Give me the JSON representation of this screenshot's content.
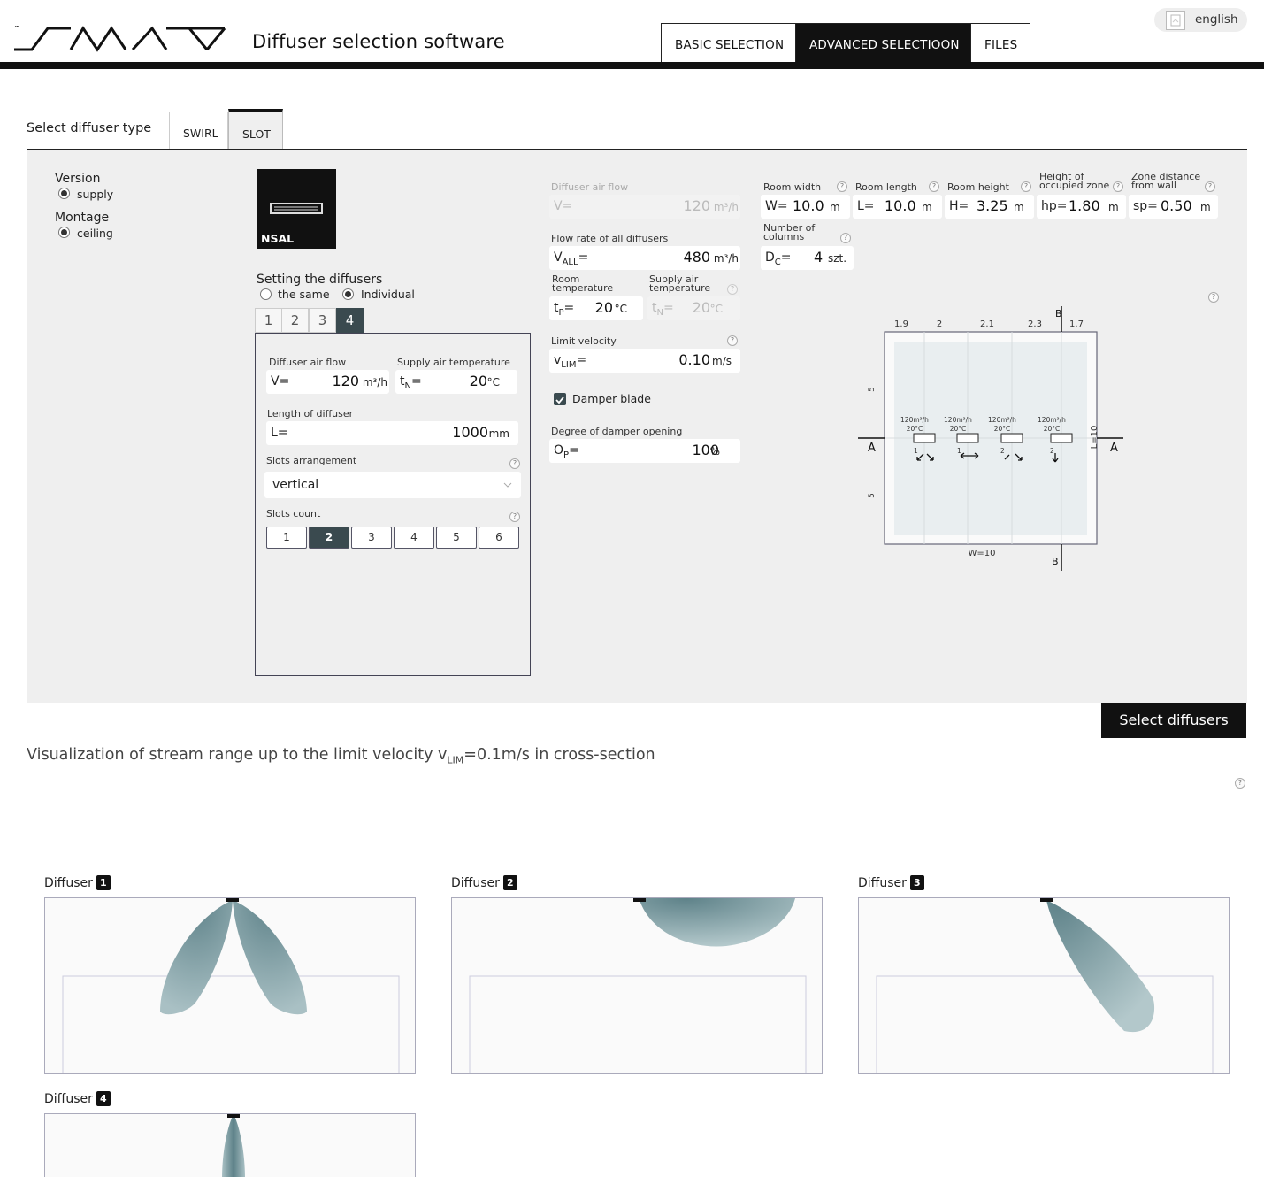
{
  "header": {
    "logo_tm": "™",
    "app_title": "Diffuser selection software",
    "tabs": [
      {
        "label": "BASIC SELECTION",
        "active": false
      },
      {
        "label": "ADVANCED SELECTIOON",
        "active": true
      },
      {
        "label": "FILES",
        "active": false
      }
    ],
    "language": "english"
  },
  "type_selector": {
    "label": "Select diffuser type",
    "tabs": [
      {
        "label": "SWIRL",
        "active": false
      },
      {
        "label": "SLOT",
        "active": true
      }
    ]
  },
  "version": {
    "label": "Version",
    "option": "supply"
  },
  "montage": {
    "label": "Montage",
    "option": "ceiling"
  },
  "product": {
    "name": "NSAL"
  },
  "setting": {
    "label": "Setting the diffusers",
    "option_same": "the same",
    "option_individual": "Individual",
    "selected": "Individual",
    "tabs": [
      "1",
      "2",
      "3",
      "4"
    ],
    "active_tab": "4"
  },
  "diffuser_settings": {
    "air_flow_label": "Diffuser air flow",
    "air_flow_prefix": "V=",
    "air_flow_value": "120",
    "air_flow_unit": "m³/h",
    "supply_temp_label": "Supply air temperature",
    "supply_temp_prefix": "tN=",
    "supply_temp_value": "20",
    "supply_temp_unit": "°C",
    "length_label": "Length of diffuser",
    "length_prefix": "L=",
    "length_value": "1000",
    "length_unit": "mm",
    "slots_arrangement_label": "Slots arrangement",
    "slots_arrangement_value": "vertical",
    "slots_count_label": "Slots count",
    "slots_count_options": [
      "1",
      "2",
      "3",
      "4",
      "5",
      "6"
    ],
    "slots_count_selected": "2"
  },
  "global_params": {
    "diffuser_air_flow_label": "Diffuser air flow",
    "diffuser_air_flow_prefix": "V=",
    "diffuser_air_flow_value": "120",
    "diffuser_air_flow_unit": "m³/h",
    "flow_all_label": "Flow rate of all diffusers",
    "flow_all_prefix": "VALL=",
    "flow_all_value": "480",
    "flow_all_unit": "m³/h",
    "room_temp_label": "Room temperature",
    "room_temp_prefix": "tP=",
    "room_temp_value": "20",
    "room_temp_unit": "°C",
    "supply_temp_label": "Supply air temperature",
    "supply_temp_prefix": "tN=",
    "supply_temp_value": "20",
    "supply_temp_unit": "°C",
    "limit_velocity_label": "Limit velocity",
    "limit_velocity_prefix": "vLIM=",
    "limit_velocity_value": "0.10",
    "limit_velocity_unit": "m/s",
    "damper_label": "Damper blade",
    "damper_checked": true,
    "damper_opening_label": "Degree of damper opening",
    "damper_opening_prefix": "OP=",
    "damper_opening_value": "100",
    "damper_opening_unit": "%"
  },
  "room": {
    "width_label": "Room width",
    "width_prefix": "W=",
    "width_value": "10.0",
    "width_unit": "m",
    "length_label": "Room length",
    "length_prefix": "L=",
    "length_value": "10.0",
    "length_unit": "m",
    "height_label": "Room height",
    "height_prefix": "H=",
    "height_value": "3.25",
    "height_unit": "m",
    "occupied_label": "Height of occupied zone",
    "occupied_prefix": "hp=",
    "occupied_value": "1.80",
    "occupied_unit": "m",
    "zone_label": "Zone distance from wall",
    "zone_prefix": "sp=",
    "zone_value": "0.50",
    "zone_unit": "m",
    "columns_label": "Number of columns",
    "columns_prefix": "DC=",
    "columns_value": "4",
    "columns_unit": "szt."
  },
  "plan": {
    "col_dims": [
      "1.9",
      "2",
      "2.1",
      "2.3",
      "1.7"
    ],
    "section_a": "A",
    "section_b": "B",
    "width_label": "W=10",
    "length_label": "L=10",
    "side_top": "5",
    "side_bottom": "5",
    "diffusers": [
      {
        "flow": "120m³/h",
        "temp": "20°C",
        "slots": "1"
      },
      {
        "flow": "120m³/h",
        "temp": "20°C",
        "slots": "1"
      },
      {
        "flow": "120m³/h",
        "temp": "20°C",
        "slots": "2"
      },
      {
        "flow": "120m³/h",
        "temp": "20°C",
        "slots": "2"
      }
    ]
  },
  "actions": {
    "select_label": "Select diffusers"
  },
  "visualization": {
    "title_prefix": "Visualization of stream range up to the limit velocity v",
    "title_sub": "LIM",
    "title_suffix": "=0.1m/s in cross-section",
    "diffuser_label": "Diffuser",
    "panels": [
      "1",
      "2",
      "3",
      "4"
    ]
  },
  "help_glyph": "?",
  "colors": {
    "dark": "#111111",
    "accent": "#3a4a4f",
    "plume": "#6d9097",
    "panel_bg": "#efefef"
  }
}
